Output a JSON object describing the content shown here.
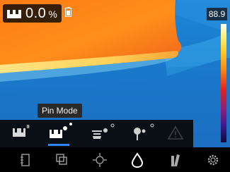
{
  "status": {
    "moisture_value": "0.0",
    "moisture_unit": "%",
    "battery_icon": "battery-icon",
    "measurement_icon": "moisture-meter-icon"
  },
  "scale": {
    "max_value": "88.9",
    "palette_colors": [
      "#ffffff",
      "#ffcf2e",
      "#ff8a12",
      "#e4231c",
      "#8b1f7c",
      "#3a1a8c",
      "#0c0a3a"
    ]
  },
  "tooltip": {
    "label": "Pin Mode"
  },
  "mode_bar": {
    "selected": "pin-mode",
    "accent_color": "#2f86ff",
    "items": [
      {
        "name": "pinless-mode",
        "icon": "pinless-sensor-icon"
      },
      {
        "name": "pin-mode",
        "icon": "pin-probe-icon"
      },
      {
        "name": "external-probe-mode",
        "icon": "external-probe-icon"
      },
      {
        "name": "hammer-probe-mode",
        "icon": "hammer-probe-icon"
      },
      {
        "name": "alarm-mode",
        "icon": "warning-triangle-icon"
      }
    ]
  },
  "toolbar": {
    "items": [
      {
        "name": "gallery",
        "icon": "image-gallery-icon"
      },
      {
        "name": "blend",
        "icon": "image-blend-icon"
      },
      {
        "name": "spot-meter",
        "icon": "crosshair-icon"
      },
      {
        "name": "moisture",
        "icon": "moisture-drop-icon",
        "active": true
      },
      {
        "name": "palette",
        "icon": "palette-icon"
      },
      {
        "name": "settings",
        "icon": "gear-icon"
      }
    ]
  }
}
